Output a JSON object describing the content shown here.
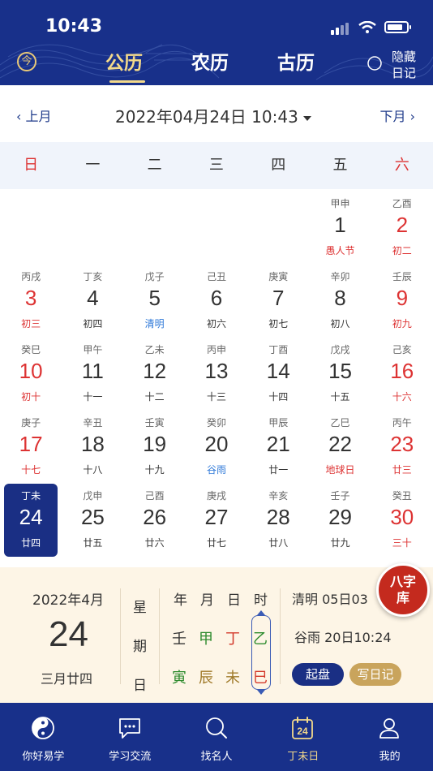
{
  "status": {
    "time": "10:43"
  },
  "header": {
    "tabs": [
      {
        "label": "公历",
        "active": true
      },
      {
        "label": "农历",
        "active": false
      },
      {
        "label": "古历",
        "active": false
      }
    ],
    "today_icon": "今",
    "hide_diary_line1": "隐藏",
    "hide_diary_line2": "日记"
  },
  "month_nav": {
    "prev": "上月",
    "next": "下月",
    "current": "2022年04月24日 10:43"
  },
  "weekdays": [
    "日",
    "一",
    "二",
    "三",
    "四",
    "五",
    "六"
  ],
  "calendar": {
    "rows": [
      [
        null,
        null,
        null,
        null,
        null,
        {
          "gz": "甲申",
          "day": "1",
          "sub": "愚人节",
          "sub_style": "red"
        },
        {
          "gz": "乙酉",
          "day": "2",
          "sub": "初二",
          "weekend": true
        }
      ],
      [
        {
          "gz": "丙戌",
          "day": "3",
          "sub": "初三",
          "weekend": true
        },
        {
          "gz": "丁亥",
          "day": "4",
          "sub": "初四"
        },
        {
          "gz": "戊子",
          "day": "5",
          "sub": "清明",
          "sub_style": "blue"
        },
        {
          "gz": "己丑",
          "day": "6",
          "sub": "初六"
        },
        {
          "gz": "庚寅",
          "day": "7",
          "sub": "初七"
        },
        {
          "gz": "辛卯",
          "day": "8",
          "sub": "初八"
        },
        {
          "gz": "壬辰",
          "day": "9",
          "sub": "初九",
          "weekend": true
        }
      ],
      [
        {
          "gz": "癸巳",
          "day": "10",
          "sub": "初十",
          "weekend": true
        },
        {
          "gz": "甲午",
          "day": "11",
          "sub": "十一"
        },
        {
          "gz": "乙未",
          "day": "12",
          "sub": "十二"
        },
        {
          "gz": "丙申",
          "day": "13",
          "sub": "十三"
        },
        {
          "gz": "丁酉",
          "day": "14",
          "sub": "十四"
        },
        {
          "gz": "戊戌",
          "day": "15",
          "sub": "十五"
        },
        {
          "gz": "己亥",
          "day": "16",
          "sub": "十六",
          "weekend": true
        }
      ],
      [
        {
          "gz": "庚子",
          "day": "17",
          "sub": "十七",
          "weekend": true
        },
        {
          "gz": "辛丑",
          "day": "18",
          "sub": "十八"
        },
        {
          "gz": "壬寅",
          "day": "19",
          "sub": "十九"
        },
        {
          "gz": "癸卯",
          "day": "20",
          "sub": "谷雨",
          "sub_style": "blue"
        },
        {
          "gz": "甲辰",
          "day": "21",
          "sub": "廿一"
        },
        {
          "gz": "乙巳",
          "day": "22",
          "sub": "地球日",
          "sub_style": "red"
        },
        {
          "gz": "丙午",
          "day": "23",
          "sub": "廿三",
          "weekend": true
        }
      ],
      [
        {
          "gz": "丁未",
          "day": "24",
          "sub": "廿四",
          "weekend": true,
          "selected": true
        },
        {
          "gz": "戊申",
          "day": "25",
          "sub": "廿五"
        },
        {
          "gz": "己酉",
          "day": "26",
          "sub": "廿六"
        },
        {
          "gz": "庚戌",
          "day": "27",
          "sub": "廿七"
        },
        {
          "gz": "辛亥",
          "day": "28",
          "sub": "廿八"
        },
        {
          "gz": "壬子",
          "day": "29",
          "sub": "廿九"
        },
        {
          "gz": "癸丑",
          "day": "30",
          "sub": "三十",
          "weekend": true
        }
      ]
    ]
  },
  "info": {
    "year_month": "2022年4月",
    "day": "24",
    "lunar": "三月廿四",
    "week_label": [
      "星",
      "期",
      "日"
    ],
    "pillar_heads": [
      "年",
      "月",
      "日",
      "时"
    ],
    "stems": [
      "壬",
      "甲",
      "丁",
      "乙"
    ],
    "branches": [
      "寅",
      "辰",
      "未",
      "巳"
    ],
    "stem_colors": [
      "#333333",
      "#2e8b2e",
      "#d33a2c",
      "#2e8b2e"
    ],
    "branch_colors": [
      "#2e8b2e",
      "#a07a2a",
      "#a07a2a",
      "#d33a2c"
    ],
    "jieqi1": "清明 05日03",
    "jieqi2": "谷雨 20日10:24",
    "btn_qipan": "起盘",
    "btn_diary": "写日记",
    "bazi_line1": "八字",
    "bazi_line2": "库"
  },
  "tabbar": [
    {
      "label": "你好易学",
      "icon": "yin-yang-icon"
    },
    {
      "label": "学习交流",
      "icon": "chat-icon"
    },
    {
      "label": "找名人",
      "icon": "search-icon"
    },
    {
      "label": "丁未日",
      "icon": "calendar-day-icon",
      "active": true,
      "badge": "24"
    },
    {
      "label": "我的",
      "icon": "user-icon"
    }
  ],
  "colors": {
    "primary": "#18308a",
    "gold": "#f3d98a",
    "red": "#d33333",
    "panel": "#fdf5e6"
  }
}
